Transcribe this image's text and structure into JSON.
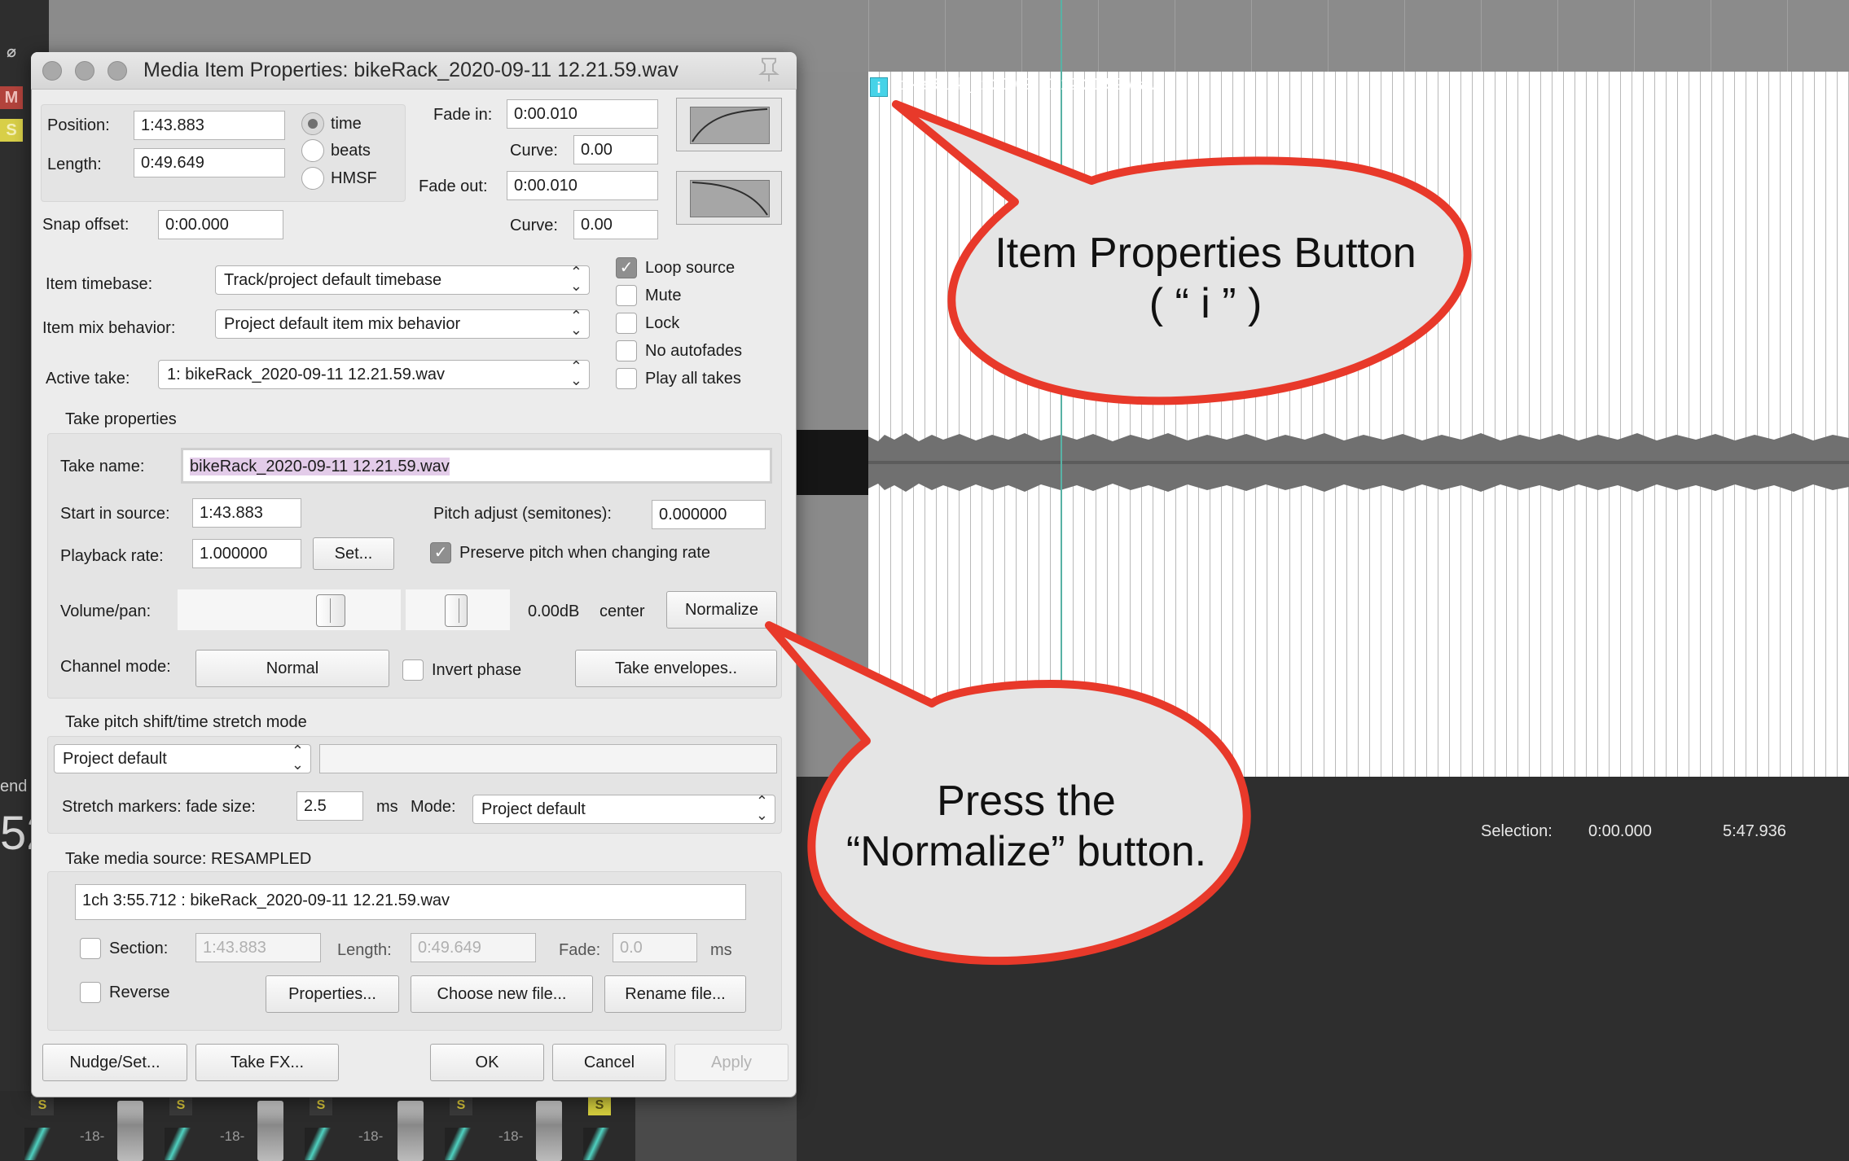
{
  "daw": {
    "item_label": "bikeRack_2020-09-11 12.21.59.wav",
    "item_info_button": "i",
    "selection_label": "Selection:",
    "selection_start": "0:00.000",
    "selection_end": "5:47.936",
    "left_strip": {
      "phase_icon": "⌀",
      "m": "M",
      "s": "S"
    },
    "send_label": "end",
    "big_digits": "52",
    "mixer_solo": "S",
    "mixer_db": "-18-"
  },
  "dialog": {
    "title": "Media Item Properties:  bikeRack_2020-09-11 12.21.59.wav",
    "position_label": "Position:",
    "position_value": "1:43.883",
    "length_label": "Length:",
    "length_value": "0:49.649",
    "snap_label": "Snap offset:",
    "snap_value": "0:00.000",
    "radio_time": "time",
    "radio_beats": "beats",
    "radio_hmsf": "HMSF",
    "fade_in_label": "Fade in:",
    "fade_in_value": "0:00.010",
    "fade_in_curve_label": "Curve:",
    "fade_in_curve_value": "0.00",
    "fade_out_label": "Fade out:",
    "fade_out_value": "0:00.010",
    "fade_out_curve_label": "Curve:",
    "fade_out_curve_value": "0.00",
    "timebase_label": "Item timebase:",
    "timebase_value": "Track/project default timebase",
    "mix_label": "Item mix behavior:",
    "mix_value": "Project default item mix behavior",
    "active_take_label": "Active take:",
    "active_take_value": "1: bikeRack_2020-09-11 12.21.59.wav",
    "loop_source": "Loop source",
    "mute": "Mute",
    "lock": "Lock",
    "no_autofades": "No autofades",
    "play_all_takes": "Play all takes",
    "take_props_header": "Take properties",
    "take_name_label": "Take name:",
    "take_name_value": "bikeRack_2020-09-11 12.21.59.wav",
    "start_source_label": "Start in source:",
    "start_source_value": "1:43.883",
    "pitch_label": "Pitch adjust (semitones):",
    "pitch_value": "0.000000",
    "rate_label": "Playback rate:",
    "rate_value": "1.000000",
    "set_button": "Set...",
    "preserve_pitch": "Preserve pitch when changing rate",
    "volpan_label": "Volume/pan:",
    "vol_value": "0.00dB",
    "pan_value": "center",
    "normalize_button": "Normalize",
    "channel_label": "Channel mode:",
    "channel_value": "Normal",
    "invert_phase": "Invert phase",
    "take_env_button": "Take envelopes..",
    "pitch_shift_header": "Take pitch shift/time stretch mode",
    "pitch_shift_value": "Project default",
    "stretch_label": "Stretch markers: fade size:",
    "stretch_value": "2.5",
    "stretch_unit": "ms",
    "mode_label": "Mode:",
    "mode_value": "Project default",
    "media_source_header": "Take media source:  RESAMPLED",
    "media_source_value": "1ch 3:55.712 : bikeRack_2020-09-11 12.21.59.wav",
    "section_label": "Section:",
    "section_value": "1:43.883",
    "src_length_label": "Length:",
    "src_length_value": "0:49.649",
    "fade_label": "Fade:",
    "fade_value": "0.0",
    "fade_unit": "ms",
    "reverse_label": "Reverse",
    "properties_button": "Properties...",
    "choose_file_button": "Choose new file...",
    "rename_file_button": "Rename file...",
    "nudge_button": "Nudge/Set...",
    "take_fx_button": "Take FX...",
    "ok_button": "OK",
    "cancel_button": "Cancel",
    "apply_button": "Apply"
  },
  "callouts": {
    "item_props_line1": "Item Properties Button",
    "item_props_line2": "( “ i ” )",
    "normalize_line1": "Press the",
    "normalize_line2": "“Normalize” button."
  },
  "colors": {
    "callout_border": "#e8392a",
    "callout_fill": "#e5e5e5",
    "cursor": "#58b2a5",
    "item_info": "#46d3e8"
  }
}
